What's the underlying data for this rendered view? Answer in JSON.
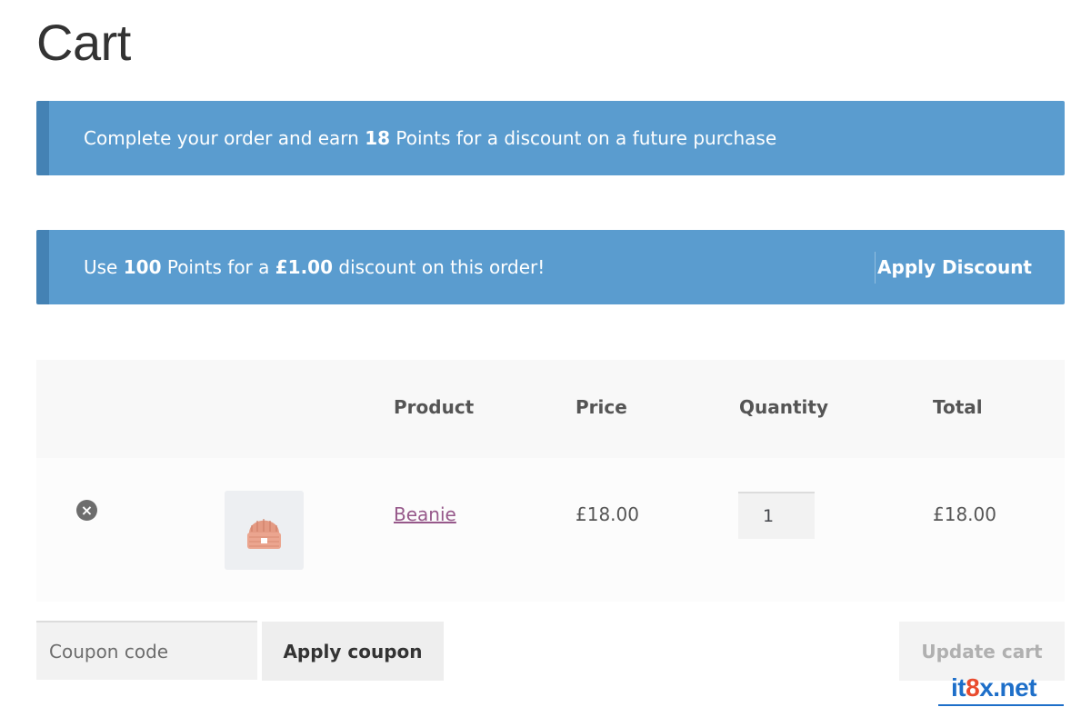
{
  "page": {
    "title": "Cart"
  },
  "notices": {
    "earn": {
      "prefix": "Complete your order and earn ",
      "points": "18",
      "suffix": " Points for a discount on a future purchase"
    },
    "use": {
      "prefix": "Use ",
      "points": "100",
      "middle": " Points for a ",
      "amount": "£1.00",
      "suffix": " discount on this order!",
      "action_label": "Apply Discount"
    },
    "colors": {
      "background": "#5a9ccf",
      "accent_border": "#4482b4"
    }
  },
  "cart": {
    "columns": [
      "",
      "",
      "Product",
      "Price",
      "Quantity",
      "Total"
    ],
    "items": [
      {
        "remove_icon": "remove-circle-icon",
        "thumbnail_icon": "beanie-icon",
        "name": "Beanie",
        "price": "£18.00",
        "quantity": "1",
        "total": "£18.00"
      }
    ],
    "link_color": "#96588a"
  },
  "actions": {
    "coupon_placeholder": "Coupon code",
    "apply_coupon_label": "Apply coupon",
    "update_cart_label": "Update cart"
  },
  "watermark": {
    "text_parts": [
      "it",
      "8",
      "x",
      ".net"
    ]
  }
}
